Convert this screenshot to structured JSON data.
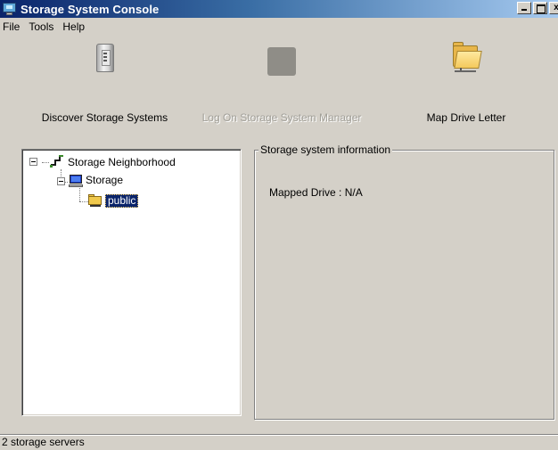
{
  "window": {
    "title": "Storage System Console",
    "icon": "storage-console-icon",
    "controls": [
      "minimize-icon",
      "maximize-icon",
      "close-icon"
    ]
  },
  "menu": {
    "items": [
      "File",
      "Tools",
      "Help"
    ]
  },
  "toolbar": {
    "buttons": [
      {
        "label": "Discover Storage Systems",
        "icon": "computer-case-icon",
        "enabled": true
      },
      {
        "label": "Log On Storage System Manager",
        "icon": "blank-grey-icon",
        "enabled": false
      },
      {
        "label": "Map Drive Letter",
        "icon": "folder-icon",
        "enabled": true
      }
    ]
  },
  "tree": {
    "root": {
      "label": "Storage Neighborhood",
      "icon": "network-icon",
      "expanded": true
    },
    "server": {
      "label": "Storage",
      "icon": "computer-icon",
      "expanded": true
    },
    "share": {
      "label": "public",
      "icon": "shared-folder-icon",
      "selected": true
    }
  },
  "info_panel": {
    "title": "Storage system information",
    "mapped_drive_label": "Mapped Drive :",
    "mapped_drive_value": "N/A"
  },
  "status": {
    "text": "2 storage servers"
  },
  "colors": {
    "title_gradient_start": "#0a246a",
    "title_gradient_end": "#a6caf0",
    "window_face": "#d4d0c8",
    "selection": "#0a246a"
  }
}
